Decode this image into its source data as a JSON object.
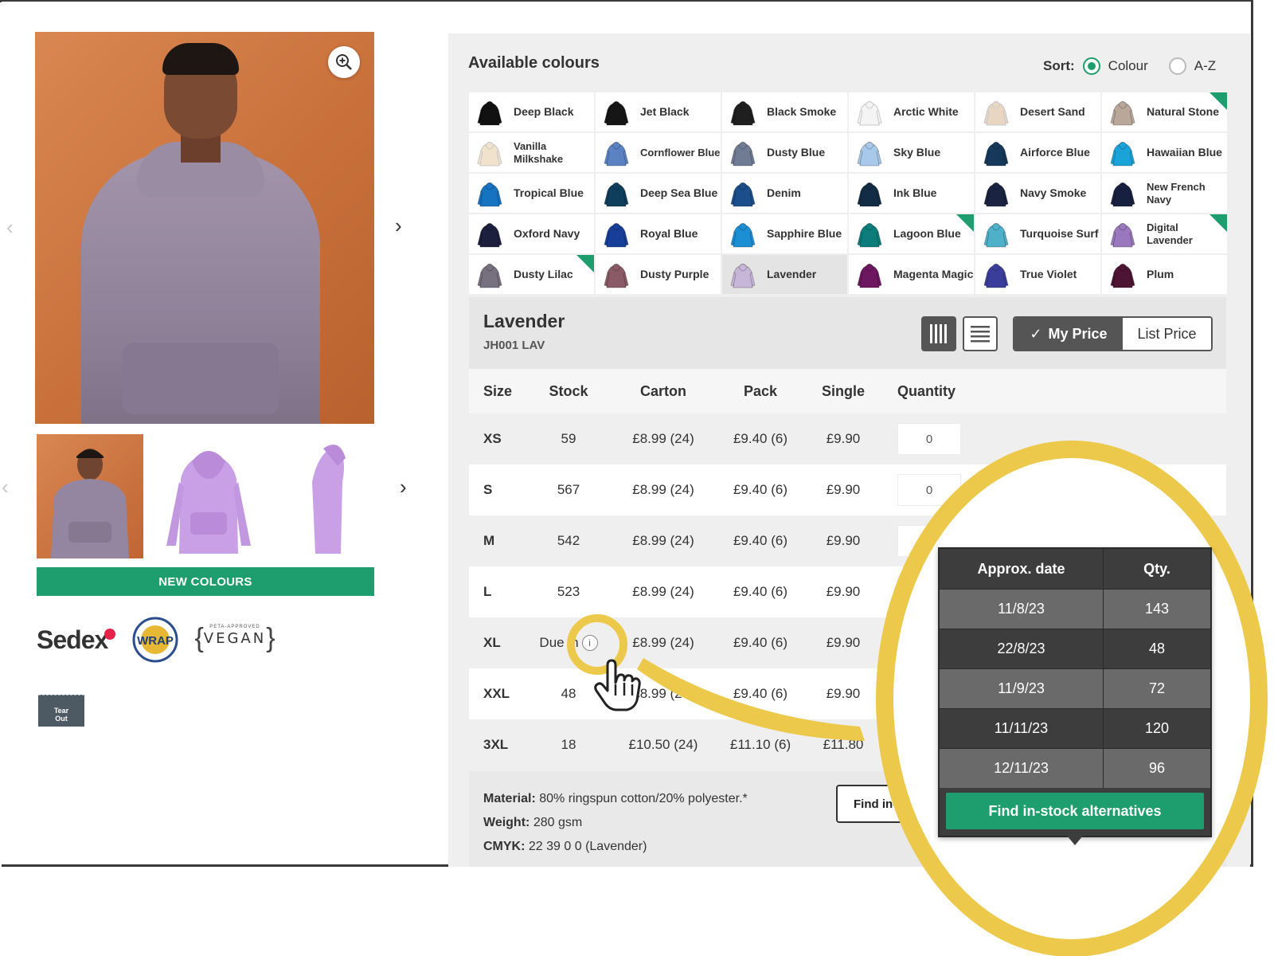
{
  "colours_section": {
    "title": "Available colours",
    "sort_label": "Sort:",
    "sort_options": [
      "Colour",
      "A-Z"
    ],
    "sort_selected": "Colour"
  },
  "swatches": [
    {
      "name": "Deep Black",
      "color": "#111111",
      "flag": false
    },
    {
      "name": "Jet Black",
      "color": "#161616",
      "flag": false
    },
    {
      "name": "Black Smoke",
      "color": "#1f1f1f",
      "flag": false
    },
    {
      "name": "Arctic White",
      "color": "#f4f4f4",
      "flag": false
    },
    {
      "name": "Desert Sand",
      "color": "#e9d6c2",
      "flag": false
    },
    {
      "name": "Natural Stone",
      "color": "#b9a89a",
      "flag": true
    },
    {
      "name": "Vanilla Milkshake",
      "color": "#f1e2cc",
      "flag": false
    },
    {
      "name": "Cornflower Blue",
      "color": "#5b83c4",
      "flag": false
    },
    {
      "name": "Dusty Blue",
      "color": "#6f7c93",
      "flag": false
    },
    {
      "name": "Sky Blue",
      "color": "#a9c9ea",
      "flag": false
    },
    {
      "name": "Airforce Blue",
      "color": "#15385b",
      "flag": false
    },
    {
      "name": "Hawaiian Blue",
      "color": "#1aa3d8",
      "flag": false
    },
    {
      "name": "Tropical Blue",
      "color": "#1673c2",
      "flag": false
    },
    {
      "name": "Deep Sea Blue",
      "color": "#0e3e5c",
      "flag": false
    },
    {
      "name": "Denim",
      "color": "#1b4e8a",
      "flag": false
    },
    {
      "name": "Ink Blue",
      "color": "#132c45",
      "flag": false
    },
    {
      "name": "Navy Smoke",
      "color": "#1a2340",
      "flag": false
    },
    {
      "name": "New French Navy",
      "color": "#18203f",
      "flag": false
    },
    {
      "name": "Oxford Navy",
      "color": "#1c1f3d",
      "flag": false
    },
    {
      "name": "Royal Blue",
      "color": "#173f9a",
      "flag": false
    },
    {
      "name": "Sapphire Blue",
      "color": "#1c8ed4",
      "flag": false
    },
    {
      "name": "Lagoon Blue",
      "color": "#0d7d7b",
      "flag": true
    },
    {
      "name": "Turquoise Surf",
      "color": "#4fb0c9",
      "flag": false
    },
    {
      "name": "Digital Lavender",
      "color": "#9a78bd",
      "flag": true
    },
    {
      "name": "Dusty Lilac",
      "color": "#77707f",
      "flag": true
    },
    {
      "name": "Dusty Purple",
      "color": "#8a5a66",
      "flag": false
    },
    {
      "name": "Lavender",
      "color": "#c7b6d8",
      "flag": false
    },
    {
      "name": "Magenta Magic",
      "color": "#6d1760",
      "flag": false
    },
    {
      "name": "True Violet",
      "color": "#3a3e9a",
      "flag": false
    },
    {
      "name": "Plum",
      "color": "#4d1433",
      "flag": false
    }
  ],
  "selected": {
    "name": "Lavender",
    "code": "JH001 LAV",
    "price_my": "My Price",
    "price_list": "List Price",
    "check": "✓"
  },
  "table": {
    "headers": {
      "size": "Size",
      "stock": "Stock",
      "carton": "Carton",
      "pack": "Pack",
      "single": "Single",
      "quantity": "Quantity"
    },
    "rows": [
      {
        "size": "XS",
        "stock": "59",
        "carton": "£8.99 (24)",
        "pack": "£9.40 (6)",
        "single": "£9.90",
        "qty": "0"
      },
      {
        "size": "S",
        "stock": "567",
        "carton": "£8.99 (24)",
        "pack": "£9.40 (6)",
        "single": "£9.90",
        "qty": "0"
      },
      {
        "size": "M",
        "stock": "542",
        "carton": "£8.99 (24)",
        "pack": "£9.40 (6)",
        "single": "£9.90",
        "qty": ""
      },
      {
        "size": "L",
        "stock": "523",
        "carton": "£8.99 (24)",
        "pack": "£9.40 (6)",
        "single": "£9.90",
        "qty": ""
      },
      {
        "size": "XL",
        "stock": "Due in",
        "carton": "£8.99 (24)",
        "pack": "£9.40 (6)",
        "single": "£9.90",
        "qty": ""
      },
      {
        "size": "XXL",
        "stock": "48",
        "carton": "£8.99 (24)",
        "pack": "£9.40 (6)",
        "single": "£9.90",
        "qty": ""
      },
      {
        "size": "3XL",
        "stock": "18",
        "carton": "£10.50 (24)",
        "pack": "£11.10 (6)",
        "single": "£11.80",
        "qty": ""
      }
    ]
  },
  "specs": {
    "material_label": "Material:",
    "material_value": "80% ringspun cotton/20% polyester.*",
    "weight_label": "Weight:",
    "weight_value": "280 gsm",
    "cmyk_label": "CMYK:",
    "cmyk_value": "22 39 0 0 (Lavender)",
    "find_button_partial": "Find in-"
  },
  "tooltip": {
    "date_header": "Approx. date",
    "qty_header": "Qty.",
    "rows": [
      {
        "date": "11/8/23",
        "qty": "143"
      },
      {
        "date": "22/8/23",
        "qty": "48"
      },
      {
        "date": "11/9/23",
        "qty": "72"
      },
      {
        "date": "11/11/23",
        "qty": "120"
      },
      {
        "date": "12/11/23",
        "qty": "96"
      }
    ],
    "button": "Find in-stock alternatives"
  },
  "gallery": {
    "banner": "NEW COLOURS",
    "tear_out_line1": "Tear",
    "tear_out_line2": "Out"
  },
  "certifications": {
    "sedex": "Sedex",
    "vegan": "VEGAN",
    "vegan_top": "PETA-APPROVED",
    "wrap": "WRAP"
  },
  "colors": {
    "accent_green": "#1e9e6e",
    "highlight_yellow": "#ecc94b",
    "product_lavender": "#c7b6d8"
  }
}
